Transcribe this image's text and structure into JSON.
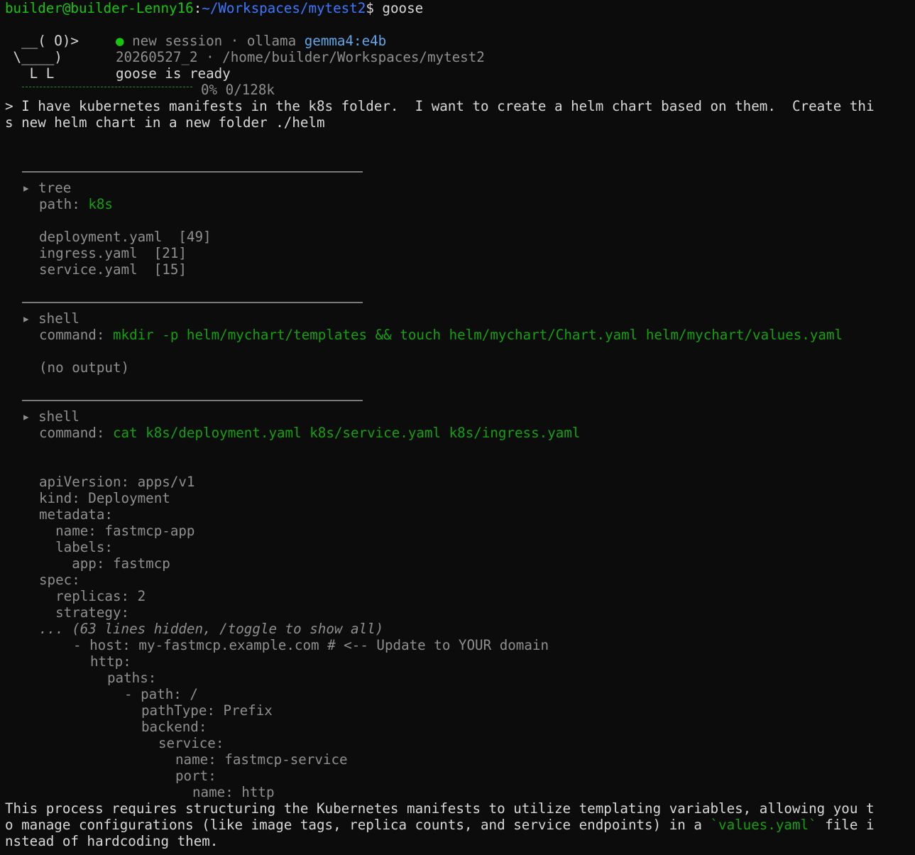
{
  "prompt": {
    "user_host": "builder@builder-Lenny16",
    "sep": ":",
    "path": "~/Workspaces/mytest2",
    "dollar": "$ ",
    "command": "goose"
  },
  "banner": {
    "logo_line1": "  __( O)>",
    "logo_line2": " \\____)",
    "logo_line3": "   L L",
    "status_dot": "●",
    "session_text": " new session · ollama ",
    "model": "gemma4:e4b",
    "session_id": "20260527_2 · /home/builder/Workspaces/mytest2",
    "ready": "goose is ready",
    "context_usage": "0% 0/128k"
  },
  "user_message": {
    "line1": "> I have kubernetes manifests in the k8s folder.  I want to create a helm chart based on them.  Create thi",
    "line2": "s new helm chart in a new folder ./helm"
  },
  "tool_calls": [
    {
      "name": "tree",
      "param_label": "path: ",
      "param_value": "k8s",
      "output": [
        "deployment.yaml  [49]",
        "ingress.yaml  [21]",
        "service.yaml  [15]"
      ]
    },
    {
      "name": "shell",
      "param_label": "command: ",
      "param_value": "mkdir -p helm/mychart/templates && touch helm/mychart/Chart.yaml helm/mychart/values.yaml",
      "output": [
        "(no output)"
      ]
    },
    {
      "name": "shell",
      "param_label": "command: ",
      "param_value": "cat k8s/deployment.yaml k8s/service.yaml k8s/ingress.yaml",
      "output_head": [
        "apiVersion: apps/v1",
        "kind: Deployment",
        "metadata:",
        "  name: fastmcp-app",
        "  labels:",
        "    app: fastmcp",
        "spec:",
        "  replicas: 2",
        "  strategy:"
      ],
      "hidden_note": "... (63 lines hidden, /toggle to show all)",
      "output_tail": [
        "- host: my-fastmcp.example.com # <-- Update to YOUR domain",
        "http:",
        "paths:",
        "- path: /",
        "pathType: Prefix",
        "backend:",
        "service:",
        "name: fastmcp-service",
        "port:",
        "name: http"
      ]
    }
  ],
  "expand_marker": "▸ ",
  "assistant": {
    "line1": "This process requires structuring the Kubernetes manifests to utilize templating variables, allowing you t",
    "line2_pre": "o manage configurations (like image tags, replica counts, and service endpoints) in a ",
    "line2_code": "`values.yaml`",
    "line2_post": " file i",
    "line3": "nstead of hardcoding them."
  }
}
